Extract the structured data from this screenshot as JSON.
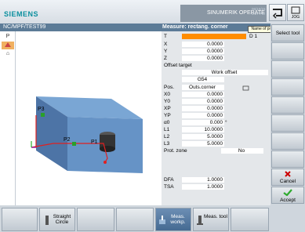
{
  "header": {
    "brand": "SIEMENS",
    "operate": "SINUMERIK OPERATE",
    "time": "06/10/15 4:37 PM",
    "jog_label": "JOG"
  },
  "titlebar": {
    "path": "NC/MPF/TEST99",
    "form_title": "Measure: rectang. corner"
  },
  "left_tabs": [
    "P",
    "",
    "⌂"
  ],
  "graphic": {
    "p1": "P1",
    "p2": "P2",
    "p3": "P3"
  },
  "form": {
    "rows": [
      {
        "label": "T",
        "value": "",
        "unit": "D 1"
      },
      {
        "label": "X",
        "value": "0.0000",
        "unit": ""
      },
      {
        "label": "Y",
        "value": "0.0000",
        "unit": ""
      },
      {
        "label": "Z",
        "value": "0.0000",
        "unit": ""
      },
      {
        "label": "Offset target",
        "value": "",
        "unit": ""
      },
      {
        "label": "",
        "value": "Work offset",
        "unit": ""
      },
      {
        "label": "",
        "value": "G54",
        "unit": ""
      },
      {
        "label": "Pos.",
        "value": "Outs.corner",
        "unit": ""
      },
      {
        "label": "X0",
        "value": "0.0000",
        "unit": ""
      },
      {
        "label": "Y0",
        "value": "0.0000",
        "unit": ""
      },
      {
        "label": "XP",
        "value": "0.0000",
        "unit": ""
      },
      {
        "label": "YP",
        "value": "0.0000",
        "unit": ""
      },
      {
        "label": "α0",
        "value": "0.000",
        "unit": "°"
      },
      {
        "label": "L1",
        "value": "10.0000",
        "unit": ""
      },
      {
        "label": "L2",
        "value": "5.0000",
        "unit": ""
      },
      {
        "label": "L3",
        "value": "5.0000",
        "unit": ""
      },
      {
        "label": "Prot. zone",
        "value": "No",
        "unit": ""
      },
      {
        "label": "",
        "value": "",
        "unit": ""
      },
      {
        "label": "DFA",
        "value": "1.0000",
        "unit": ""
      },
      {
        "label": "TSA",
        "value": "1.0000",
        "unit": ""
      }
    ]
  },
  "tooltip": "Name of probe",
  "softkeys": {
    "select_tool": "Select tool",
    "cancel": "Cancel",
    "accept": "Accept"
  },
  "hkeys": {
    "straight_circle": "Straight Circle",
    "meas_workp": "Meas. workp.",
    "meas_tool": "Meas. tool"
  },
  "colors": {
    "accent": "#ff8c00",
    "titlebar": "#5c7b97",
    "accept": "#2eaa2e",
    "cancel": "#cc0000"
  }
}
